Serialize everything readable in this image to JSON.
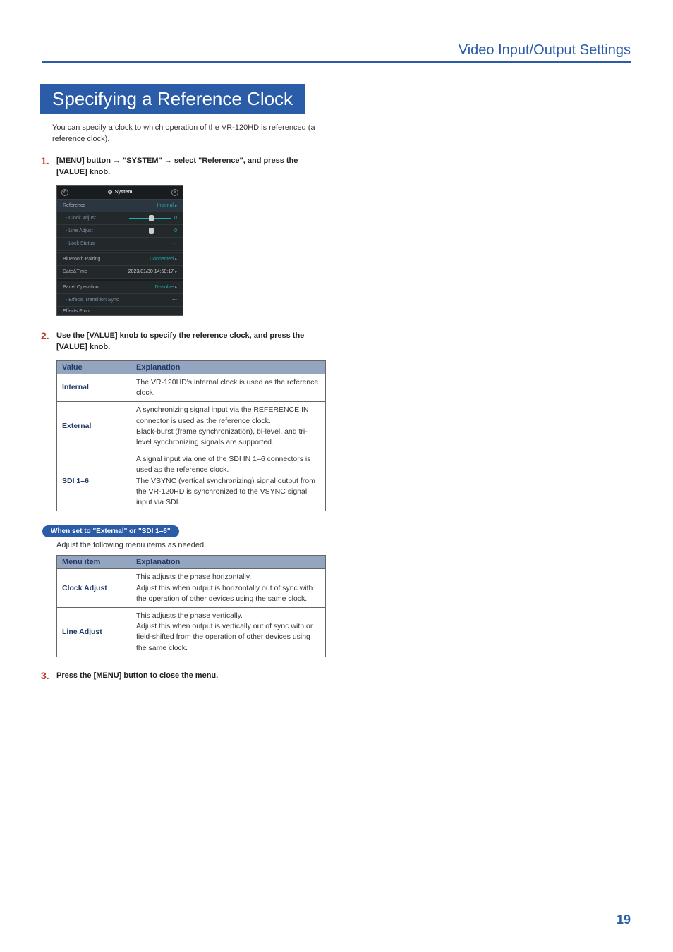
{
  "header": {
    "category": "Video Input/Output Settings"
  },
  "section": {
    "title": "Specifying a Reference Clock"
  },
  "intro": "You can specify a clock to which operation of the VR-120HD is referenced (a reference clock).",
  "steps": {
    "s1": {
      "num": "1.",
      "prefix": "[MENU] button ",
      "mid1": " \"SYSTEM\" ",
      "mid2": " select \"Reference\", and press the [VALUE] knob."
    },
    "s2": {
      "num": "2.",
      "text": "Use the [VALUE] knob to specify the reference clock, and press the [VALUE] knob."
    },
    "s3": {
      "num": "3.",
      "text": "Press the [MENU] button to close the menu."
    }
  },
  "screenshot": {
    "title": "System",
    "rows": {
      "reference": {
        "label": "Reference",
        "value": "Internal"
      },
      "clockadjust": {
        "label": "- Clock Adjust",
        "value": "0"
      },
      "lineadjust": {
        "label": "- Line Adjust",
        "value": "0"
      },
      "lockstatus": {
        "label": "- Lock Status",
        "value": "---"
      },
      "bluetooth": {
        "label": "Bluetooth Pairing",
        "value": "Connected"
      },
      "datetime": {
        "label": "Date&Time",
        "value": "2023/01/30 14:50:17"
      },
      "panelop": {
        "label": "Panel Operation",
        "value": "Dissolve"
      },
      "efftrans": {
        "label": "- Effects Transition Sync",
        "value": "---"
      },
      "efffront": {
        "label": "Effects Front"
      }
    }
  },
  "table1": {
    "h1": "Value",
    "h2": "Explanation",
    "r1": {
      "k": "Internal",
      "v": "The VR-120HD's internal clock is used as the reference clock."
    },
    "r2": {
      "k": "External",
      "v1": "A synchronizing signal input via the REFERENCE IN connector is used as the reference clock.",
      "v2": "Black-burst (frame synchronization), bi-level, and tri-level synchronizing signals are supported."
    },
    "r3": {
      "k": "SDI 1–6",
      "v1": "A signal input via one of the SDI IN 1–6 connectors is used as the reference clock.",
      "v2": "The VSYNC (vertical synchronizing) signal output from the VR-120HD is synchronized to the VSYNC signal input via SDI."
    }
  },
  "pill": "When set to \"External\" or \"SDI 1–6\"",
  "subtext": "Adjust the following menu items as needed.",
  "table2": {
    "h1": "Menu item",
    "h2": "Explanation",
    "r1": {
      "k": "Clock Adjust",
      "v1": "This adjusts the phase horizontally.",
      "v2": "Adjust this when output is horizontally out of sync with the operation of other devices using the same clock."
    },
    "r2": {
      "k": "Line Adjust",
      "v1": "This adjusts the phase vertically.",
      "v2": "Adjust this when output is vertically out of sync with or field-shifted from the operation of other devices using the same clock."
    }
  },
  "pagenum": "19"
}
